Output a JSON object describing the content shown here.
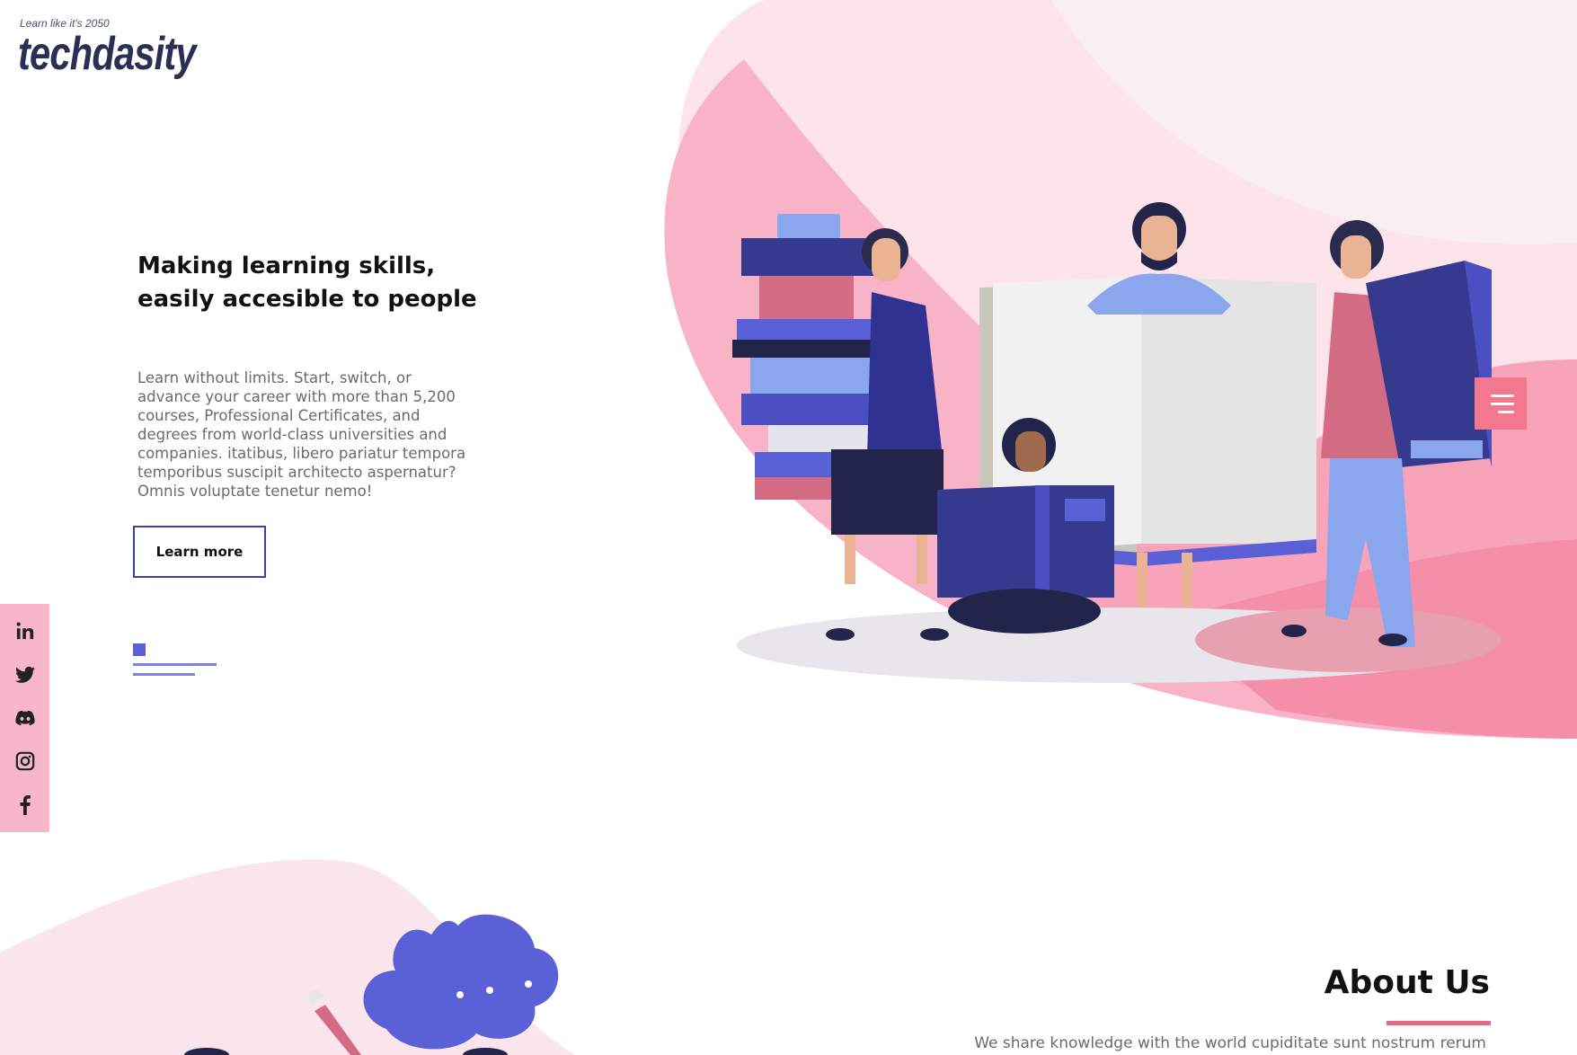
{
  "brand": {
    "tagline": "Learn like it's 2050",
    "name": "techdasity"
  },
  "hero": {
    "title": "Making learning skills, easily accesible to people",
    "description": "Learn without limits. Start, switch, or advance your career with more than 5,200 courses, Professional Certificates, and degrees from world-class universities and companies. itatibus, libero pariatur tempora temporibus suscipit architecto aspernatur? Omnis voluptate tenetur nemo!",
    "cta_label": "Learn more"
  },
  "social": [
    {
      "name": "linkedin-icon"
    },
    {
      "name": "twitter-icon"
    },
    {
      "name": "discord-icon"
    },
    {
      "name": "instagram-icon"
    },
    {
      "name": "facebook-icon"
    }
  ],
  "menu": {
    "icon": "hamburger-menu-icon"
  },
  "about": {
    "title": "About Us",
    "text": "We share knowledge with the world cupiditate sunt nostrum rerum"
  },
  "colors": {
    "accent_blue": "#5a60d6",
    "pink": "#f7b7c9",
    "pink_strong": "#f2778f",
    "navy": "#2b2f55"
  }
}
